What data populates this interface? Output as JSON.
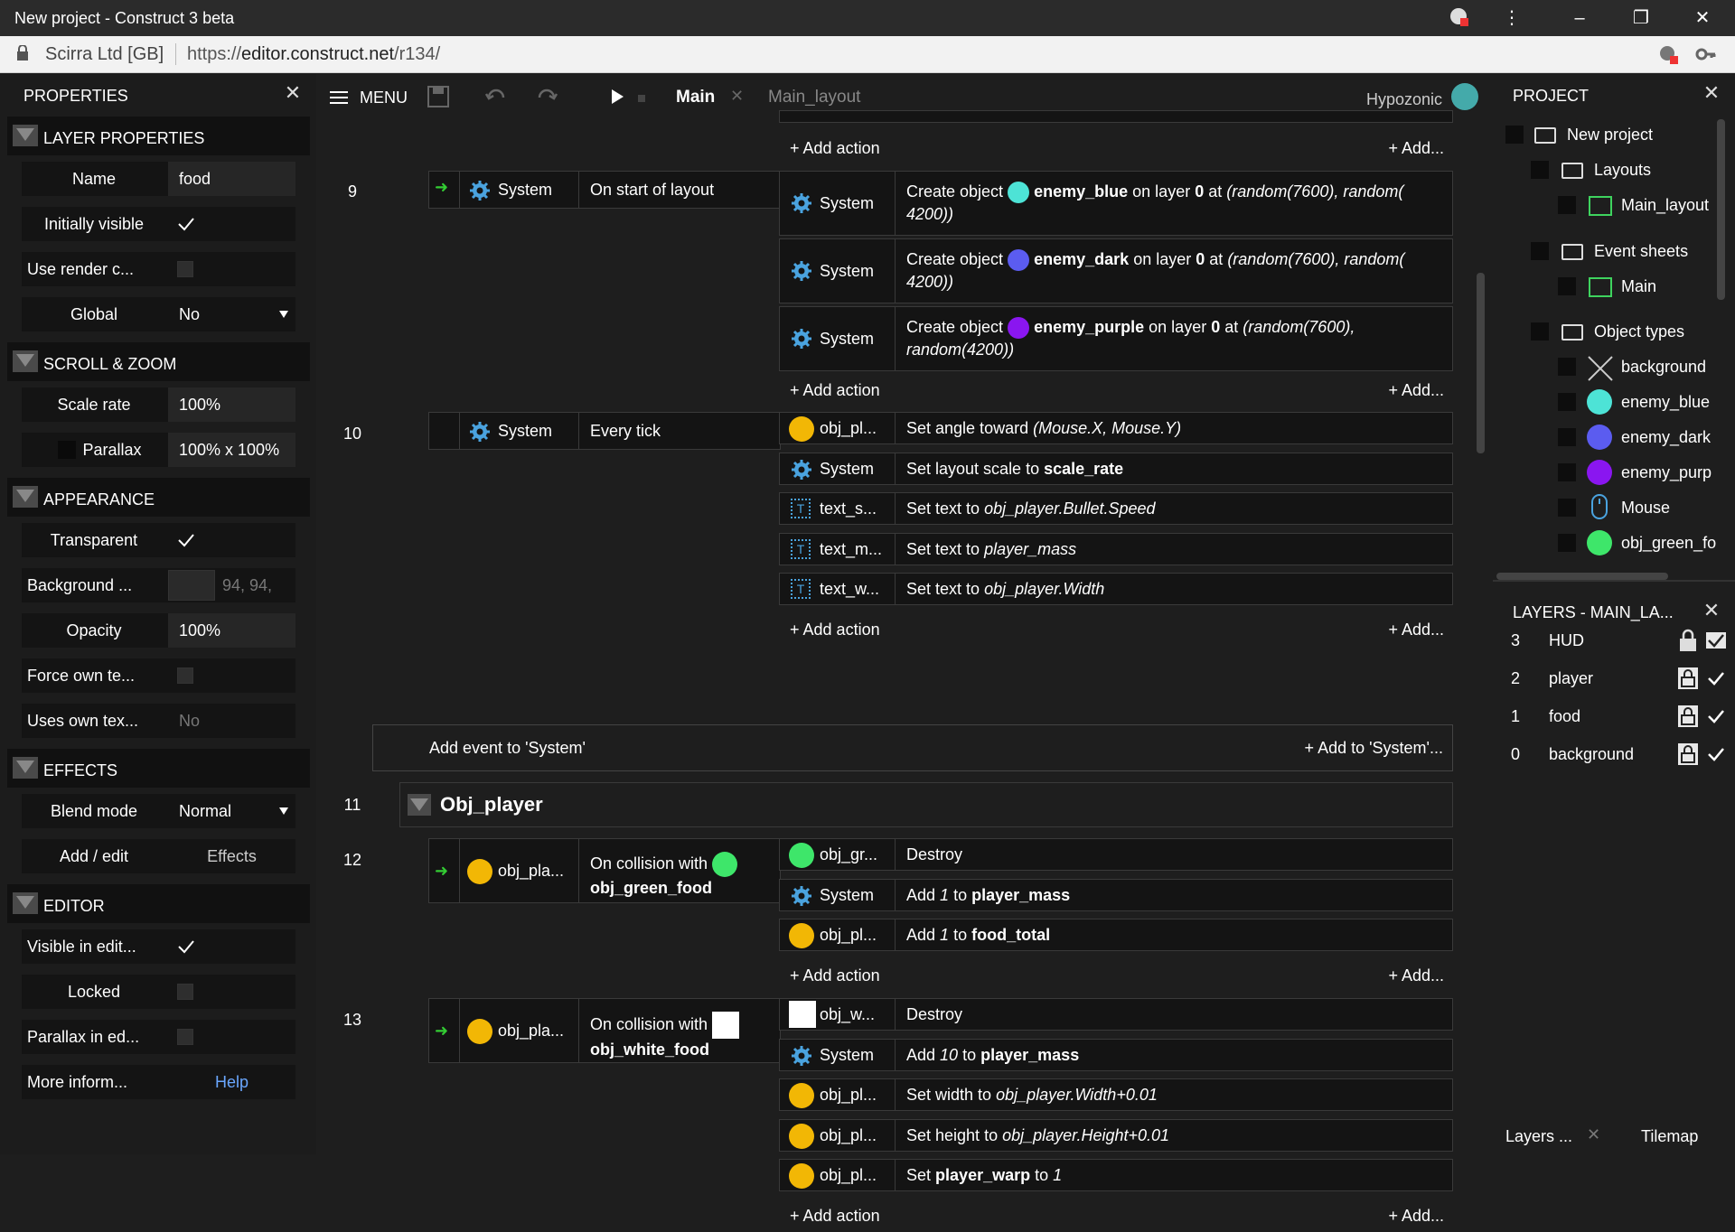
{
  "window": {
    "title": "New project - Construct 3 beta"
  },
  "address": {
    "org": "Scirra Ltd [GB]",
    "url_prefix": "https://",
    "url_host": "editor.construct.net",
    "url_path": "/r134/"
  },
  "properties": {
    "title": "PROPERTIES",
    "sections": {
      "layer": "LAYER PROPERTIES",
      "scroll": "SCROLL & ZOOM",
      "appearance": "APPEARANCE",
      "effects": "EFFECTS",
      "editor": "EDITOR"
    },
    "rows": {
      "name_label": "Name",
      "name_value": "food",
      "visible_label": "Initially visible",
      "render_label": "Use render c...",
      "global_label": "Global",
      "global_value": "No",
      "scale_label": "Scale rate",
      "scale_value": "100%",
      "parallax_label": "Parallax",
      "parallax_value": "100% x 100%",
      "transparent_label": "Transparent",
      "bg_label": "Background ...",
      "bg_value": "94, 94,",
      "opacity_label": "Opacity",
      "opacity_value": "100%",
      "force_label": "Force own te...",
      "uses_label": "Uses own tex...",
      "uses_value": "No",
      "blend_label": "Blend mode",
      "blend_value": "Normal",
      "addedit_label": "Add / edit",
      "addedit_value": "Effects",
      "visedit_label": "Visible in edit...",
      "locked_label": "Locked",
      "parallaxed_label": "Parallax in ed...",
      "more_label": "More inform...",
      "more_value": "Help"
    }
  },
  "toolbar": {
    "menu": "MENU",
    "tab_main": "Main",
    "tab_layout": "Main_layout",
    "user": "Hypozonic"
  },
  "events": {
    "add_action": "Add action",
    "add_short": "Add...",
    "e9": {
      "num": "9",
      "obj": "System",
      "cond": "On start of layout",
      "actions": [
        {
          "obj": "System",
          "pre": "Create object",
          "name": "enemy_blue",
          "mid": "on layer",
          "layer": "0",
          "at": "at",
          "expr1": "(random(7600), random(",
          "expr2": "4200))"
        },
        {
          "obj": "System",
          "pre": "Create object",
          "name": "enemy_dark",
          "mid": "on layer",
          "layer": "0",
          "at": "at",
          "expr1": "(random(7600), random(",
          "expr2": "4200))"
        },
        {
          "obj": "System",
          "pre": "Create object",
          "name": "enemy_purple",
          "mid": "on layer",
          "layer": "0",
          "at": "at",
          "expr1": "(random(7600),",
          "expr2": "random(4200))"
        }
      ]
    },
    "e10": {
      "num": "10",
      "obj": "System",
      "cond": "Every tick",
      "actions": [
        {
          "obj": "obj_pl...",
          "text": "Set angle toward",
          "expr": "(Mouse.X, Mouse.Y)"
        },
        {
          "obj": "System",
          "text": "Set layout scale to",
          "bold": "scale_rate"
        },
        {
          "obj": "text_s...",
          "text": "Set text to",
          "expr": "obj_player.Bullet.Speed"
        },
        {
          "obj": "text_m...",
          "text": "Set text to",
          "expr": "player_mass"
        },
        {
          "obj": "text_w...",
          "text": "Set text to",
          "expr": "obj_player.Width"
        }
      ]
    },
    "add_event": "Add event to 'System'",
    "add_to_system": "Add to 'System'...",
    "e11": {
      "num": "11",
      "group": "Obj_player"
    },
    "e12": {
      "num": "12",
      "obj": "obj_pla...",
      "cond1": "On collision with",
      "cond2": "obj_green_food",
      "actions": [
        {
          "obj": "obj_gr...",
          "text": "Destroy"
        },
        {
          "obj": "System",
          "pre": "Add",
          "num": "1",
          "to": "to",
          "bold": "player_mass"
        },
        {
          "obj": "obj_pl...",
          "pre": "Add",
          "num": "1",
          "to": "to",
          "bold": "food_total"
        }
      ]
    },
    "e13": {
      "num": "13",
      "obj": "obj_pla...",
      "cond1": "On collision with",
      "cond2": "obj_white_food",
      "actions": [
        {
          "obj": "obj_w...",
          "text": "Destroy"
        },
        {
          "obj": "System",
          "pre": "Add",
          "num": "10",
          "to": "to",
          "bold": "player_mass"
        },
        {
          "obj": "obj_pl...",
          "text": "Set width to",
          "expr": "obj_player.Width+0.01"
        },
        {
          "obj": "obj_pl...",
          "text": "Set height to",
          "expr": "obj_player.Height+0.01"
        },
        {
          "obj": "obj_pl...",
          "pre": "Set",
          "bold": "player_warp",
          "to": "to",
          "num": "1"
        }
      ]
    }
  },
  "project": {
    "title": "PROJECT",
    "root": "New project",
    "layouts": "Layouts",
    "main_layout": "Main_layout",
    "event_sheets": "Event sheets",
    "main": "Main",
    "object_types": "Object types",
    "objects": [
      "background",
      "enemy_blue",
      "enemy_dark",
      "enemy_purp",
      "Mouse",
      "obj_green_fo"
    ]
  },
  "layers": {
    "title": "LAYERS - MAIN_LA...",
    "rows": [
      {
        "num": "3",
        "name": "HUD"
      },
      {
        "num": "2",
        "name": "player"
      },
      {
        "num": "1",
        "name": "food"
      },
      {
        "num": "0",
        "name": "background"
      }
    ],
    "tab_layers": "Layers ...",
    "tab_tilemap": "Tilemap"
  },
  "colors": {
    "enemy_blue": "#4de3d6",
    "enemy_dark": "#5b5cf0",
    "enemy_purple": "#8a16f0",
    "green_food": "#3ee66a",
    "accent": "#4aa3df"
  }
}
